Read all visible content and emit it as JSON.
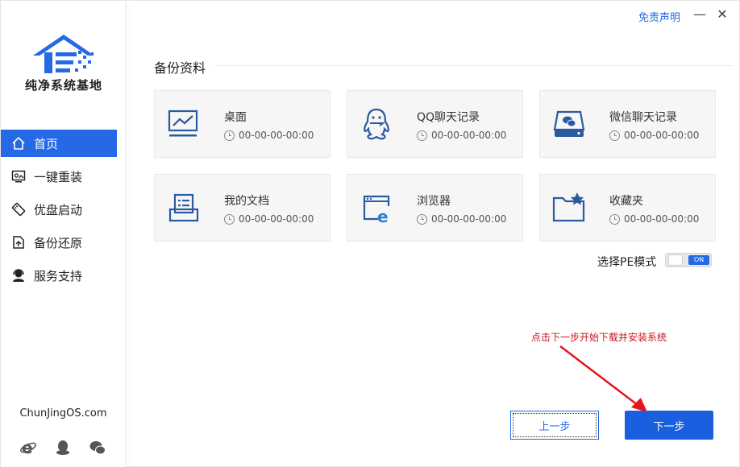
{
  "brand": {
    "name": "纯净系统基地",
    "site": "ChunJingOS.com"
  },
  "topbar": {
    "disclaimer": "免责声明",
    "minimize": "—",
    "close": "✕"
  },
  "nav": [
    {
      "label": "首页",
      "icon": "home-icon",
      "active": true
    },
    {
      "label": "一键重装",
      "icon": "reinstall-icon",
      "active": false
    },
    {
      "label": "优盘启动",
      "icon": "usb-boot-icon",
      "active": false
    },
    {
      "label": "备份还原",
      "icon": "backup-restore-icon",
      "active": false
    },
    {
      "label": "服务支持",
      "icon": "support-icon",
      "active": false
    }
  ],
  "section": {
    "title": "备份资料"
  },
  "cards": [
    {
      "name": "桌面",
      "time": "00-00-00-00:00",
      "icon": "desktop-icon"
    },
    {
      "name": "QQ聊天记录",
      "time": "00-00-00-00:00",
      "icon": "qq-icon"
    },
    {
      "name": "微信聊天记录",
      "time": "00-00-00-00:00",
      "icon": "wechat-disk-icon"
    },
    {
      "name": "我的文档",
      "time": "00-00-00-00:00",
      "icon": "documents-icon"
    },
    {
      "name": "浏览器",
      "time": "00-00-00-00:00",
      "icon": "browser-icon"
    },
    {
      "name": "收藏夹",
      "time": "00-00-00-00:00",
      "icon": "favorites-folder-icon"
    }
  ],
  "pe_mode": {
    "label": "选择PE模式",
    "state": "ON"
  },
  "hint": "点击下一步开始下载并安装系统",
  "buttons": {
    "prev": "上一步",
    "next": "下一步"
  },
  "colors": {
    "accent": "#2569e6",
    "hint": "#c8161d"
  }
}
